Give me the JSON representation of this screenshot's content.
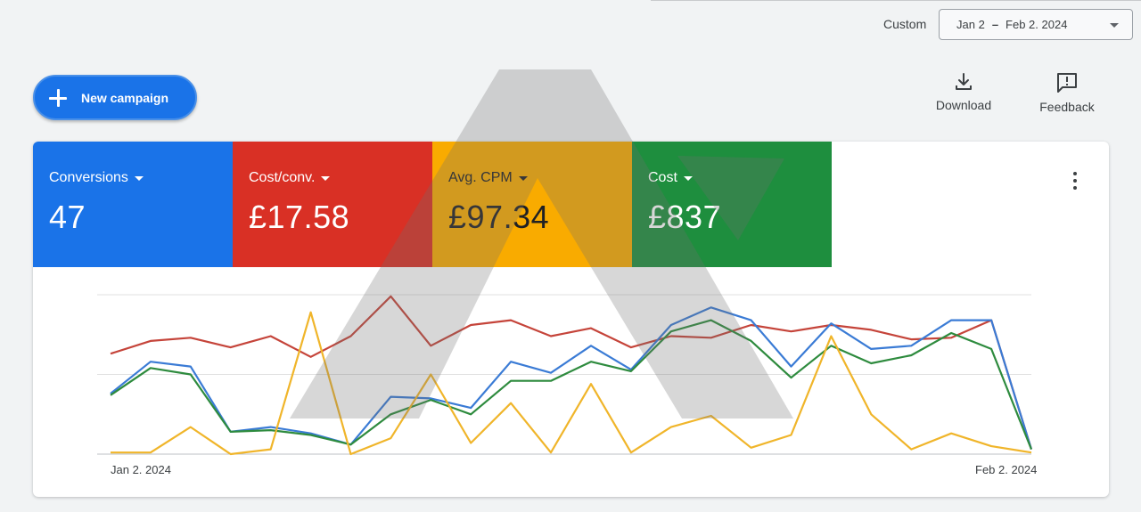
{
  "header": {
    "date_range_label": "Custom",
    "date_start": "Jan 2",
    "date_separator": "–",
    "date_end": "Feb 2. 2024"
  },
  "actions": {
    "new_campaign_label": "New campaign",
    "download_label": "Download",
    "feedback_label": "Feedback"
  },
  "icons": {
    "new_campaign": "plus-icon",
    "download": "download-icon",
    "feedback": "feedback-icon",
    "more": "more-vert-icon",
    "metric_dropdown": "caret-down-icon"
  },
  "metrics": [
    {
      "label": "Conversions",
      "value": "47",
      "color": "#1a73e8",
      "text_color": "#ffffff"
    },
    {
      "label": "Cost/conv.",
      "value": "£17.58",
      "color": "#d93025",
      "text_color": "#ffffff"
    },
    {
      "label": "Avg. CPM",
      "value": "£97.34",
      "color": "#f9ab00",
      "text_color": "#202124"
    },
    {
      "label": "Cost",
      "value": "£837",
      "color": "#1e8e3e",
      "text_color": "#ffffff"
    }
  ],
  "chart_data": {
    "type": "line",
    "x_start_label": "Jan 2. 2024",
    "x_end_label": "Feb 2. 2024",
    "ylim": [
      0,
      100
    ],
    "grid": true,
    "series": [
      {
        "metric": "Cost/conv.",
        "color": "#c5443a",
        "values": [
          63,
          71,
          73,
          67,
          74,
          61,
          74,
          99,
          68,
          81,
          84,
          74,
          79,
          67,
          74,
          73,
          81,
          77,
          81,
          78,
          72,
          73,
          84,
          3
        ]
      },
      {
        "metric": "Conversions",
        "color": "#3a7bd5",
        "values": [
          38,
          58,
          55,
          14,
          17,
          13,
          6,
          36,
          35,
          29,
          58,
          51,
          68,
          53,
          81,
          92,
          84,
          55,
          82,
          66,
          68,
          84,
          84,
          3
        ]
      },
      {
        "metric": "Cost",
        "color": "#2e8b3e",
        "values": [
          37,
          54,
          50,
          14,
          15,
          12,
          6,
          25,
          34,
          25,
          46,
          46,
          58,
          52,
          77,
          84,
          71,
          48,
          68,
          57,
          62,
          76,
          66,
          3
        ]
      },
      {
        "metric": "Avg. CPM",
        "color": "#f0b52a",
        "values": [
          1,
          1,
          17,
          0,
          3,
          89,
          0,
          10,
          50,
          7,
          32,
          1,
          44,
          1,
          17,
          24,
          4,
          12,
          74,
          25,
          3,
          13,
          5,
          1
        ]
      }
    ]
  }
}
